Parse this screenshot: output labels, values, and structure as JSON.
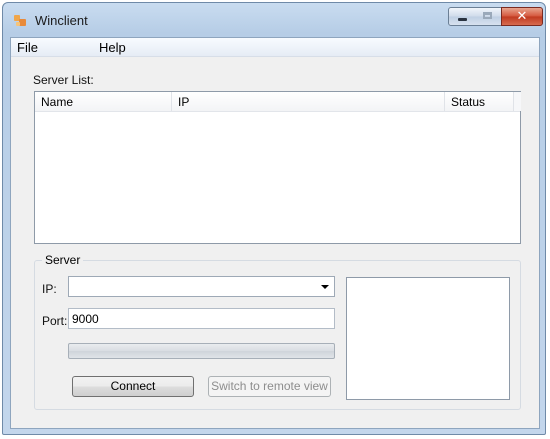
{
  "window": {
    "title": "Winclient",
    "icon": "app-icon",
    "controls": {
      "minimize": "minimize-icon",
      "maximize": "maximize-icon",
      "close": "✕"
    }
  },
  "menu": {
    "file": "File",
    "help": "Help"
  },
  "server_list": {
    "label": "Server List:",
    "columns": [
      "Name",
      "IP",
      "Status"
    ],
    "rows": []
  },
  "server_group": {
    "label": "Server",
    "ip_label": "IP:",
    "ip_value": "",
    "port_label": "Port:",
    "port_value": "9000",
    "progress": 0,
    "connect_label": "Connect",
    "remote_view_label": "Switch to remote view",
    "remote_view_enabled": false
  },
  "colors": {
    "titlebar": "#c3d6ec",
    "close_button": "#c0391f",
    "client_bg": "#f0f0f0",
    "disabled_text": "#8d8d8d"
  }
}
